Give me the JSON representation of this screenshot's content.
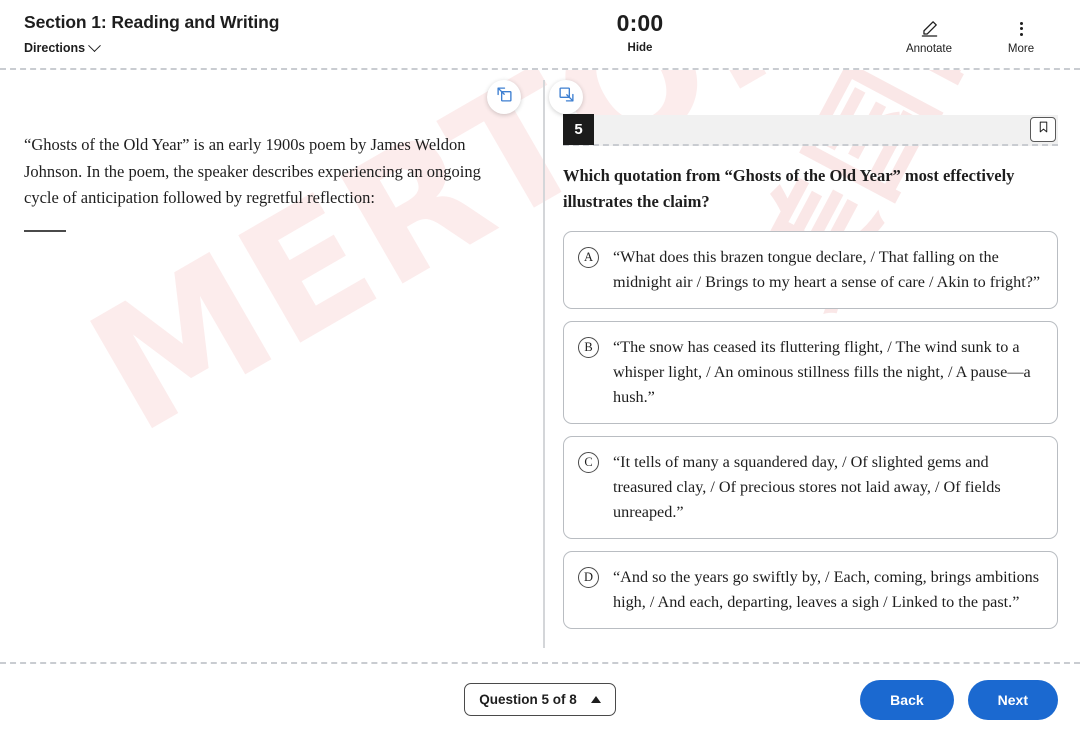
{
  "header": {
    "section_title": "Section 1: Reading and Writing",
    "directions_label": "Directions",
    "directions_icon": "chevron-down-icon",
    "timer_value": "0:00",
    "hide_label": "Hide",
    "annotate_label": "Annotate",
    "annotate_icon": "pen-highlighter-icon",
    "more_label": "More",
    "more_icon": "vertical-dots-icon"
  },
  "watermark": {
    "main_text": "MERTON",
    "secondary_text": "美国留学",
    "color": "#e56e6e"
  },
  "left_pane": {
    "expand_icon": "expand-right-icon",
    "passage": "“Ghosts of the Old Year” is an early 1900s poem by James Weldon Johnson. In the poem, the speaker describes experiencing an ongoing cycle of anticipation followed by regretful reflection:"
  },
  "right_pane": {
    "expand_icon": "expand-left-icon",
    "question_number": "5",
    "bookmark_icon": "bookmark-icon",
    "question_stem": "Which quotation from “Ghosts of the Old Year” most effectively illustrates the claim?",
    "choices": [
      {
        "letter": "A",
        "text": "“What does this brazen tongue declare, / That falling on the midnight air / Brings to my heart a sense of care / Akin to fright?”"
      },
      {
        "letter": "B",
        "text": "“The snow has ceased its fluttering flight, / The wind sunk to a whisper light, / An ominous stillness fills the night, / A pause—a hush.”"
      },
      {
        "letter": "C",
        "text": "“It tells of many a squandered day, / Of slighted gems and treasured clay, / Of precious stores not laid away, / Of fields unreaped.”"
      },
      {
        "letter": "D",
        "text": "“And so the years go swiftly by, / Each, coming, brings ambitions high, / And each, departing, leaves a sigh / Linked to the past.”"
      }
    ]
  },
  "footer": {
    "question_picker_label": "Question 5 of 8",
    "question_picker_icon": "caret-up-icon",
    "back_label": "Back",
    "next_label": "Next",
    "button_color": "#1b69d0"
  }
}
